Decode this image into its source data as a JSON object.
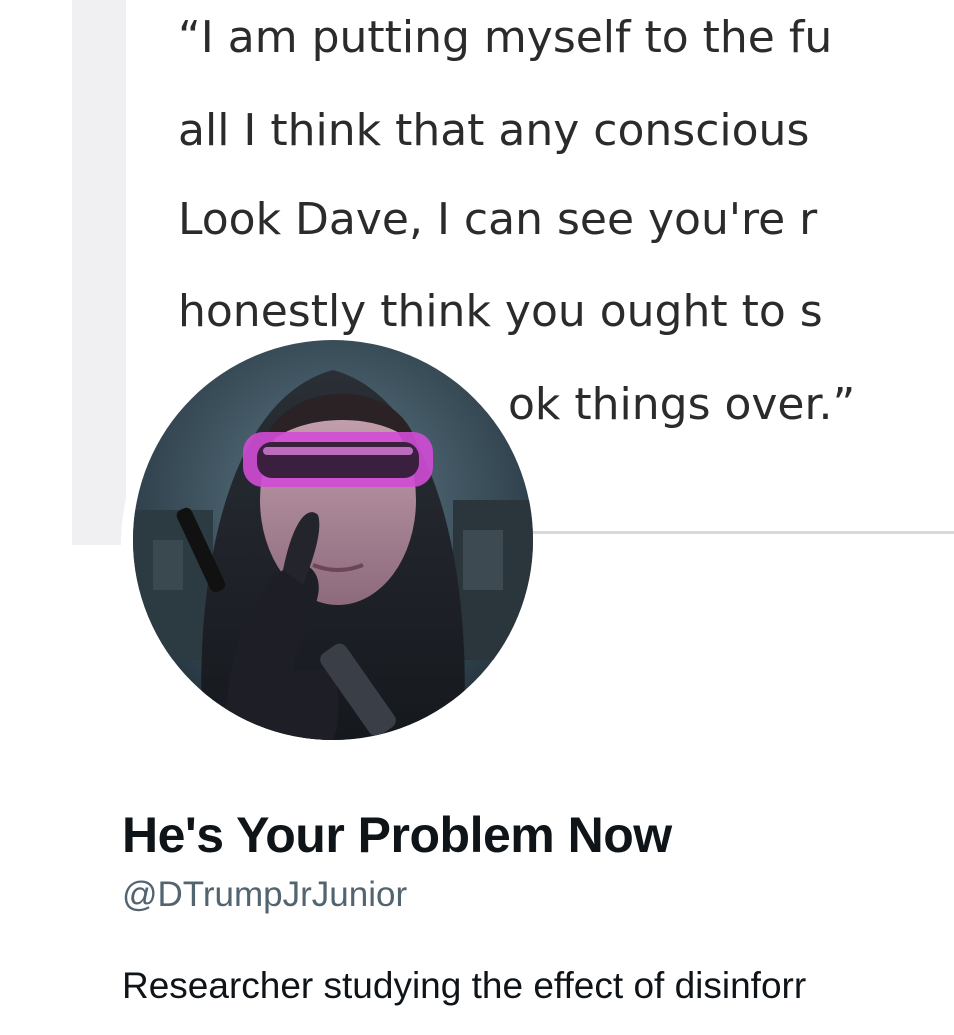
{
  "banner": {
    "quote_lines": [
      "“I am putting myself to the fu",
      "all I think that any conscious",
      "Look Dave, I can see you're r",
      "honestly think you ought to s",
      "ok things over.”"
    ]
  },
  "profile": {
    "display_name": "He's Your Problem Now",
    "handle": "@DTrumpJrJunior",
    "bio": "Researcher studying the effect of disinforr"
  },
  "colors": {
    "name_text": "#0f1419",
    "handle_text": "#536471",
    "quote_text": "#2b2b2b",
    "goggles": "#d24bd6"
  },
  "icons": {
    "avatar": "avatar-image"
  }
}
